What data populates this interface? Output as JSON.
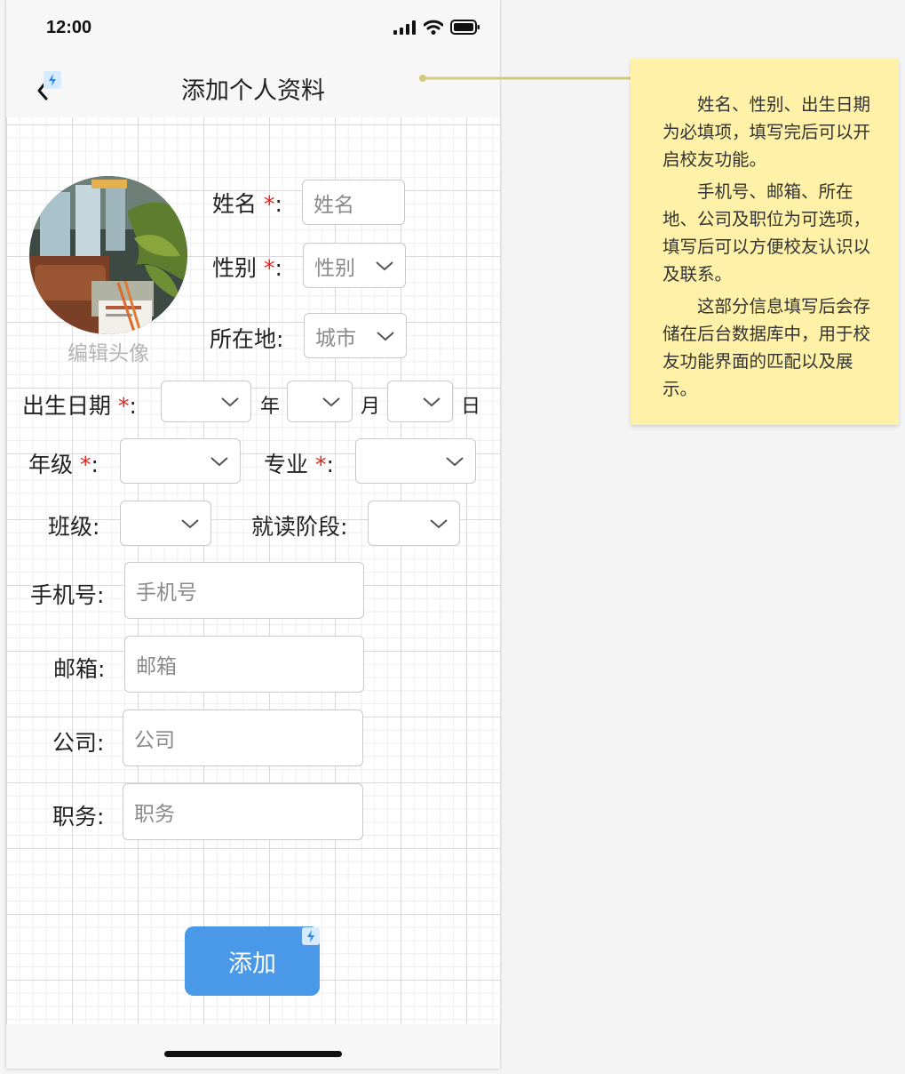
{
  "status_bar": {
    "time": "12:00",
    "icons": [
      "signal-icon",
      "wifi-icon",
      "battery-icon"
    ]
  },
  "nav": {
    "title": "添加个人资料",
    "back_icon": "chevron-left-icon"
  },
  "avatar": {
    "caption": "编辑头像"
  },
  "form": {
    "name": {
      "label": "姓名",
      "required_mark": "*",
      "colon": ":",
      "placeholder": "姓名"
    },
    "gender": {
      "label": "性别",
      "required_mark": "*",
      "colon": ":",
      "value": "性别"
    },
    "location": {
      "label": "所在地:",
      "value": "城市"
    },
    "birthdate": {
      "label": "出生日期",
      "required_mark": "*",
      "colon": ":",
      "year_unit": "年",
      "month_unit": "月",
      "day_unit": "日"
    },
    "grade": {
      "label": "年级",
      "required_mark": "*",
      "colon": ":"
    },
    "major": {
      "label": "专业",
      "required_mark": "*",
      "colon": ":"
    },
    "class": {
      "label": "班级:"
    },
    "stage": {
      "label": "就读阶段:"
    },
    "phone": {
      "label": "手机号:",
      "placeholder": "手机号"
    },
    "email": {
      "label": "邮箱:",
      "placeholder": "邮箱"
    },
    "company": {
      "label": "公司:",
      "placeholder": "公司"
    },
    "position": {
      "label": "职务:",
      "placeholder": "职务"
    }
  },
  "submit": {
    "label": "添加"
  },
  "annotation": {
    "paragraphs": [
      "姓名、性别、出生日期为必填项，填写完后可以开启校友功能。",
      "手机号、邮箱、所在地、公司及职位为可选项，填写后可以方便校友认识以及联系。",
      "这部分信息填写后会存储在后台数据库中，用于校友功能界面的匹配以及展示。"
    ]
  },
  "colors": {
    "accent": "#4a99e8",
    "required": "#e0241b",
    "note_bg": "#fff2a8",
    "connector": "#d4c77e"
  }
}
